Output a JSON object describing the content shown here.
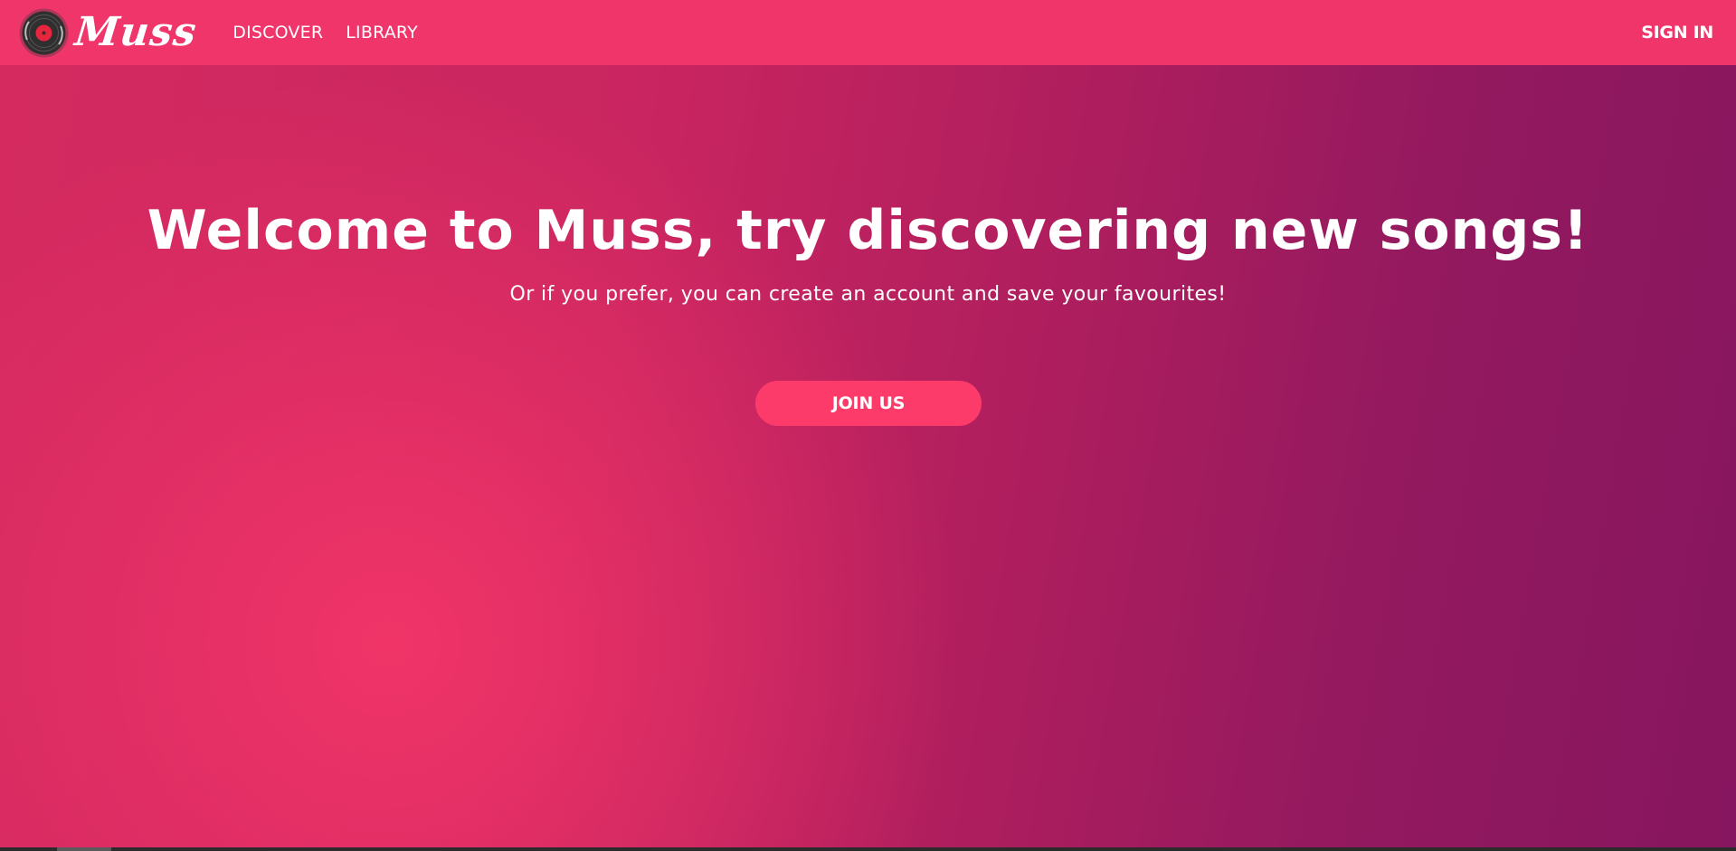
{
  "brand": {
    "name": "Muss",
    "logo_icon": "vinyl-record-icon",
    "accent_color": "#f0356a"
  },
  "nav": {
    "items": [
      {
        "label": "DISCOVER"
      },
      {
        "label": "LIBRARY"
      }
    ],
    "sign_in_label": "SIGN IN"
  },
  "hero": {
    "title": "Welcome to Muss, try discovering new songs!",
    "subtitle": "Or if you prefer, you can create an account and save your favourites!",
    "cta_label": "JOIN US",
    "cta_color": "#fd3b6a",
    "gradient_colors": [
      "#f0356a",
      "#c92560",
      "#86165f"
    ]
  }
}
